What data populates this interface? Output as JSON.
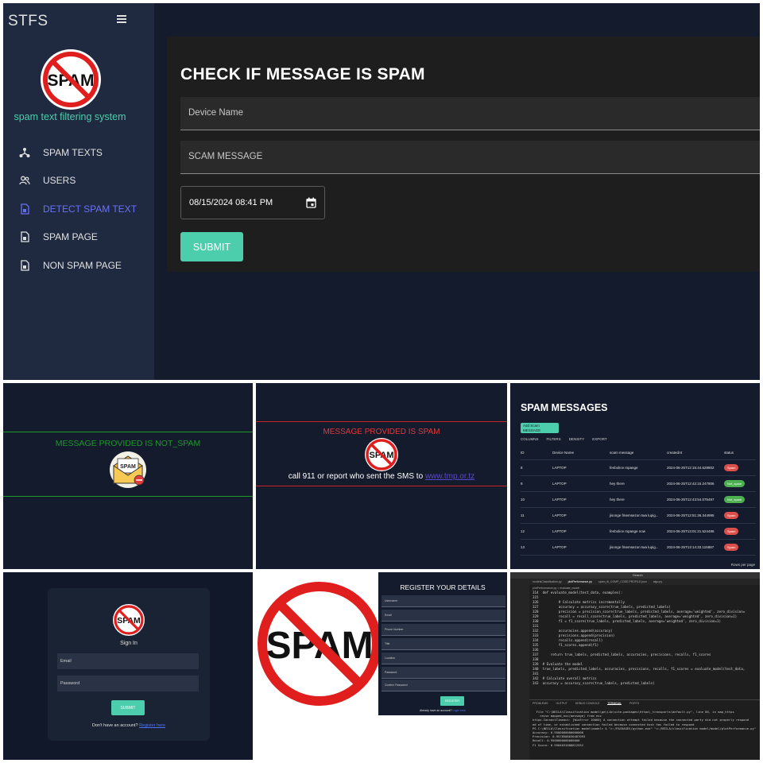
{
  "main": {
    "brand": "STFS",
    "tagline": "spam text filtering system",
    "logo_text": "SPAM",
    "nav": [
      {
        "label": "SPAM TEXTS",
        "icon": "network-icon",
        "active": false
      },
      {
        "label": "USERS",
        "icon": "users-icon",
        "active": false
      },
      {
        "label": "DETECT SPAM TEXT",
        "icon": "document-icon",
        "active": true
      },
      {
        "label": "SPAM PAGE",
        "icon": "document-icon",
        "active": false
      },
      {
        "label": "NON SPAM PAGE",
        "icon": "document-icon",
        "active": false
      }
    ],
    "form": {
      "title": "CHECK IF MESSAGE IS SPAM",
      "device_placeholder": "Device Name",
      "message_placeholder": "SCAM MESSAGE",
      "datetime": "08/15/2024 08:41 PM",
      "submit": "SUBMIT"
    },
    "colors": {
      "accent": "#4cceac",
      "active_nav": "#6870fa",
      "bg": "#141b2d",
      "sidebar": "#1f2a40"
    }
  },
  "not_spam": {
    "message": "MESSAGE PROVIDED IS NOT_SPAM",
    "icon_text": "SPAM",
    "color": "#1b9a28"
  },
  "spam": {
    "message": "MESSAGE PROVIDED IS SPAM",
    "logo_text": "SPAM",
    "call_text": "call 911 or report who sent the SMS to",
    "link_text": "www.tmp.or.tz",
    "color": "#e03a3a"
  },
  "spam_table": {
    "title": "SPAM MESSAGES",
    "add_button": "Add Scam MESSAGE",
    "toolbar": [
      "COLUMNS",
      "FILTERS",
      "DENSITY",
      "EXPORT"
    ],
    "columns": [
      "ID",
      "Device Name",
      "scam message",
      "createdAt",
      "status"
    ],
    "rows": [
      {
        "id": "8",
        "device": "LAPTOP",
        "message": "fenbolice mpange",
        "created": "2024-06-25T12:15:44.628802",
        "status": "Spam"
      },
      {
        "id": "9",
        "device": "LAPTOP",
        "message": "hey there",
        "created": "2024-06-25T12:42:15.247806",
        "status": "Not_spam"
      },
      {
        "id": "10",
        "device": "LAPTOP",
        "message": "hey there",
        "created": "2024-06-25T12:43:54.075497",
        "status": "Not_spam"
      },
      {
        "id": "11",
        "device": "LAPTOP",
        "message": "jisonge fmemsezon twa lupig...",
        "created": "2024-06-25T12:51:36.344995",
        "status": "Spam"
      },
      {
        "id": "12",
        "device": "LAPTOP",
        "message": "fenbolice mpange now",
        "created": "2024-06-25T13:01:21.524486",
        "status": "Spam"
      },
      {
        "id": "13",
        "device": "LAPTOP",
        "message": "jisonge fmemsezon twa lupig...",
        "created": "2024-06-25T13:14:33.115887",
        "status": "Spam"
      }
    ],
    "rows_per_page": "Rows per page"
  },
  "signin": {
    "logo_text": "SPAM",
    "title": "Sign In",
    "email_placeholder": "Email",
    "password_placeholder": "Password",
    "submit": "SUBMIT",
    "no_account": "Don't have an account?",
    "register_link": "Register here"
  },
  "big_logo": {
    "text": "SPAM"
  },
  "register": {
    "title": "REGISTER YOUR DETAILS",
    "fields": [
      "Username",
      "Email",
      "Phone Number",
      "Title",
      "Location",
      "Password",
      "Confirm Password"
    ],
    "submit": "REGISTER",
    "already": "Already have an account?",
    "login_link": "Login here"
  },
  "code_editor": {
    "title": "Search",
    "tabs": [
      "modelsClassification.py",
      "plotPerformance.py",
      "spam_fil_COMP_CODE.PROFILE.json",
      "algo.py"
    ],
    "breadcrumb": "plotPerformance.py > evaluate_model",
    "code_lines": [
      "314  def evaluate_model(test_data, examples):",
      "315",
      "326          # Calculate metrics incrementally",
      "327          accuracy = accuracy_score(true_labels, predicted_labels)",
      "328          precision = precision_score(true_labels, predicted_labels, average='weighted', zero_division=",
      "329          recall = recall_score(true_labels, predicted_labels, average='weighted', zero_division=1)",
      "330          f1 = f1_score(true_labels, predicted_labels, average='weighted', zero_division=1)",
      "331",
      "332          accuracies.append(accuracy)",
      "333          precisions.append(precision)",
      "334          recalls.append(recall)",
      "335          f1_scores.append(f1)",
      "336",
      "337      return true_labels, predicted_labels, accuracies, precisions, recalls, f1_scores",
      "338",
      "339  # Evaluate the model",
      "340  true_labels, predicted_labels, accuracies, precisions, recalls, f1_scores = evaluate_model(test_data,",
      "341",
      "342  # Calculate overall metrics",
      "343  accuracy = accuracy_score(true_labels, predicted_labels)"
    ],
    "terminal_tabs": [
      "PROBLEMS",
      "OUTPUT",
      "DEBUG CONSOLE",
      "TERMINAL",
      "PORTS"
    ],
    "terminal_lines": [
      "  File \"C:\\NEILA\\Classification model\\ge\\Lib\\site-packages\\httpx\\_transports\\default.py\", line 86, in map_https",
      "    raise mapped_exc(message) from exc",
      "httpx.ConnectTimeout: [WinError 10060] A connection attempt failed because the connected party did not properly respond",
      "ed of time, or established connection failed because connected host has failed to respond",
      "PS C:\\NEILA\\Classification model\\model> & \"c:/PACKAGES/python.exe\" \"c:/NEILA/classification model/model/plotPerformance.py\"",
      "Accuracy: 0.9500000000000000",
      "Precision: 0.9578508630487093",
      "Recall: 0.9500000000000000",
      "F1 Score: 0.9504031088812552"
    ]
  }
}
